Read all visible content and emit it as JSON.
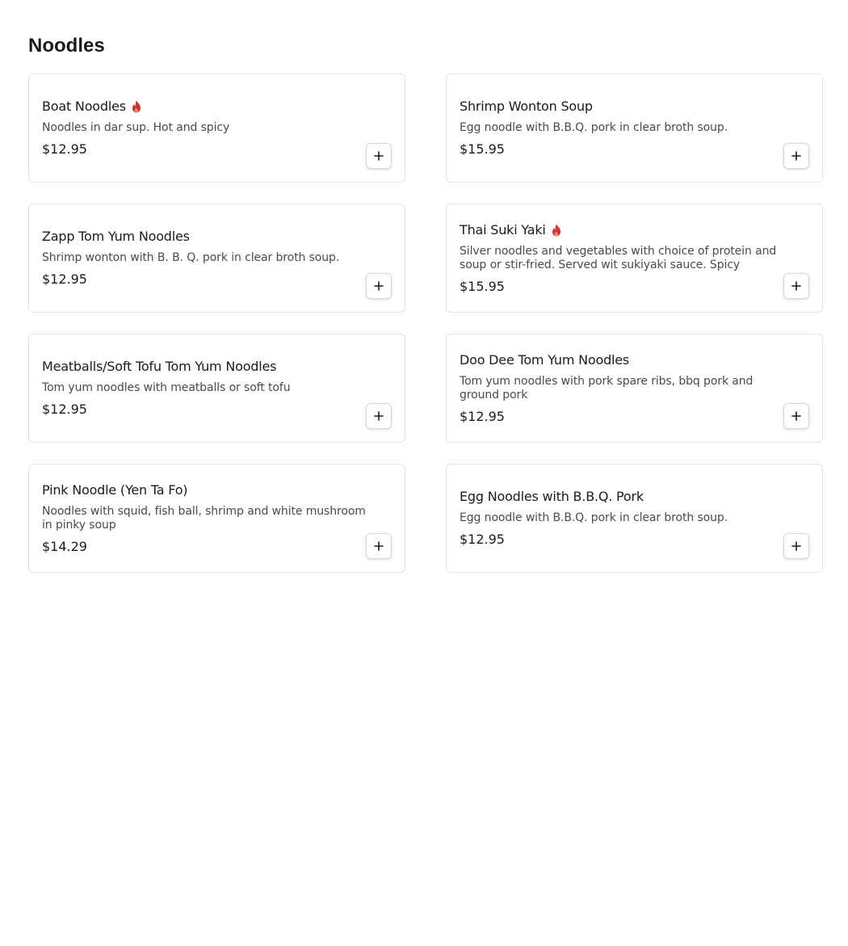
{
  "section": {
    "title": "Noodles"
  },
  "colors": {
    "spicy": "#c8372d",
    "card_border": "#e3e3e3"
  },
  "icons": {
    "spicy": "flame-icon",
    "add": "plus-icon"
  },
  "items": [
    {
      "name": "Boat Noodles",
      "spicy": true,
      "description": "Noodles in dar sup. Hot and spicy",
      "price": "$12.95"
    },
    {
      "name": "Shrimp Wonton Soup",
      "spicy": false,
      "description": "Egg noodle with B.B.Q. pork in clear broth soup.",
      "price": "$15.95"
    },
    {
      "name": "Zapp Tom Yum Noodles",
      "spicy": false,
      "description": "Shrimp wonton with B. B. Q. pork in clear broth soup.",
      "price": "$12.95"
    },
    {
      "name": "Thai Suki Yaki",
      "spicy": true,
      "description": "Silver noodles and vegetables with choice of protein and soup or stir-fried. Served wit sukiyaki sauce. Spicy",
      "price": "$15.95"
    },
    {
      "name": "Meatballs/Soft Tofu Tom Yum Noodles",
      "spicy": false,
      "description": "Tom yum noodles with meatballs or soft tofu",
      "price": "$12.95"
    },
    {
      "name": "Doo Dee Tom Yum Noodles",
      "spicy": false,
      "description": "Tom yum noodles with pork spare ribs, bbq pork and ground pork",
      "price": "$12.95"
    },
    {
      "name": "Pink Noodle (Yen Ta Fo)",
      "spicy": false,
      "description": "Noodles with squid, fish ball, shrimp and white mushroom in pinky soup",
      "price": "$14.29"
    },
    {
      "name": "Egg Noodles with B.B.Q. Pork",
      "spicy": false,
      "description": "Egg noodle with B.B.Q. pork in clear broth soup.",
      "price": "$12.95"
    }
  ]
}
